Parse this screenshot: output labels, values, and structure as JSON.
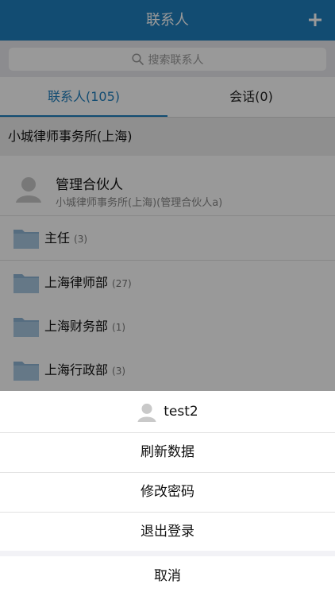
{
  "navbar": {
    "title": "联系人",
    "add_icon": "plus-icon",
    "color": "#1f7fbf"
  },
  "search": {
    "placeholder": "搜索联系人",
    "icon": "search-icon"
  },
  "tabs": [
    {
      "label": "联系人(105)",
      "active": true
    },
    {
      "label": "会话(0)",
      "active": false
    }
  ],
  "org": {
    "name": "小城律师事务所(上海)"
  },
  "person": {
    "name": "管理合伙人",
    "subtitle": "小城律师事务所(上海)(管理合伙人a)",
    "avatar_icon": "avatar-icon"
  },
  "folders": [
    {
      "name": "主任",
      "count": "(3)",
      "icon": "folder-icon"
    },
    {
      "name": "上海律师部",
      "count": "(27)",
      "icon": "folder-icon"
    },
    {
      "name": "上海财务部",
      "count": "(1)",
      "icon": "folder-icon"
    },
    {
      "name": "上海行政部",
      "count": "(3)",
      "icon": "folder-icon"
    }
  ],
  "action_sheet": {
    "user": {
      "name": "test2",
      "avatar_icon": "avatar-icon"
    },
    "refresh": "刷新数据",
    "change_password": "修改密码",
    "logout": "退出登录",
    "cancel": "取消"
  }
}
